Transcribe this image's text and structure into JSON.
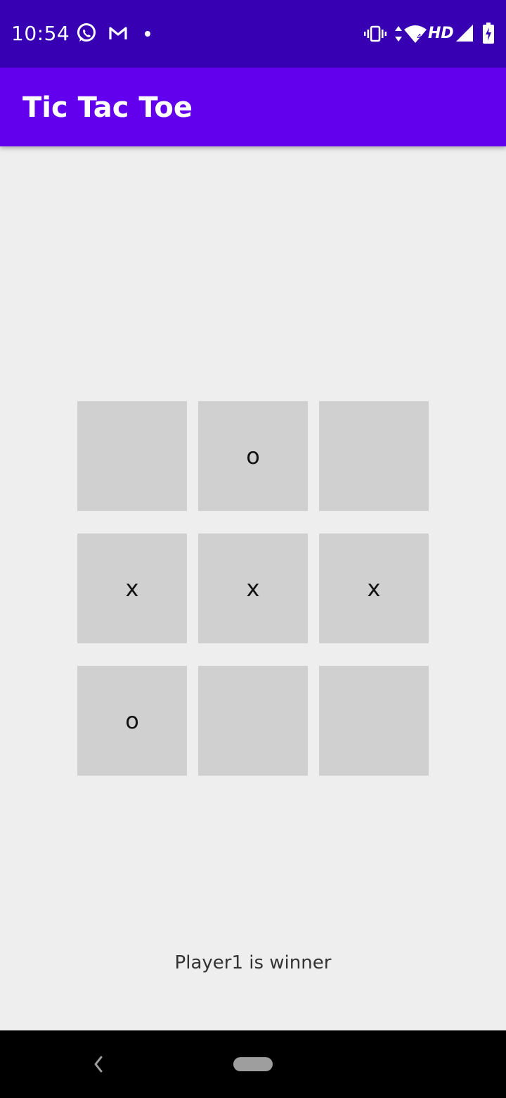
{
  "status_bar": {
    "time": "10:54",
    "network_label": "HD",
    "icons": [
      "whatsapp-icon",
      "gmail-icon",
      "notification-dot-icon",
      "vibrate-icon",
      "data-arrows-icon",
      "wifi-icon",
      "signal-icon",
      "battery-charging-icon"
    ]
  },
  "app_bar": {
    "title": "Tic Tac Toe"
  },
  "board": {
    "cells": [
      "",
      "o",
      "",
      "x",
      "x",
      "x",
      "o",
      "",
      ""
    ]
  },
  "result_text": "Player1 is winner",
  "colors": {
    "status_bar": "#3700b3",
    "app_bar": "#6200ee",
    "background": "#eeeeee",
    "cell": "#d0d0d0",
    "nav_bar": "#000000"
  }
}
